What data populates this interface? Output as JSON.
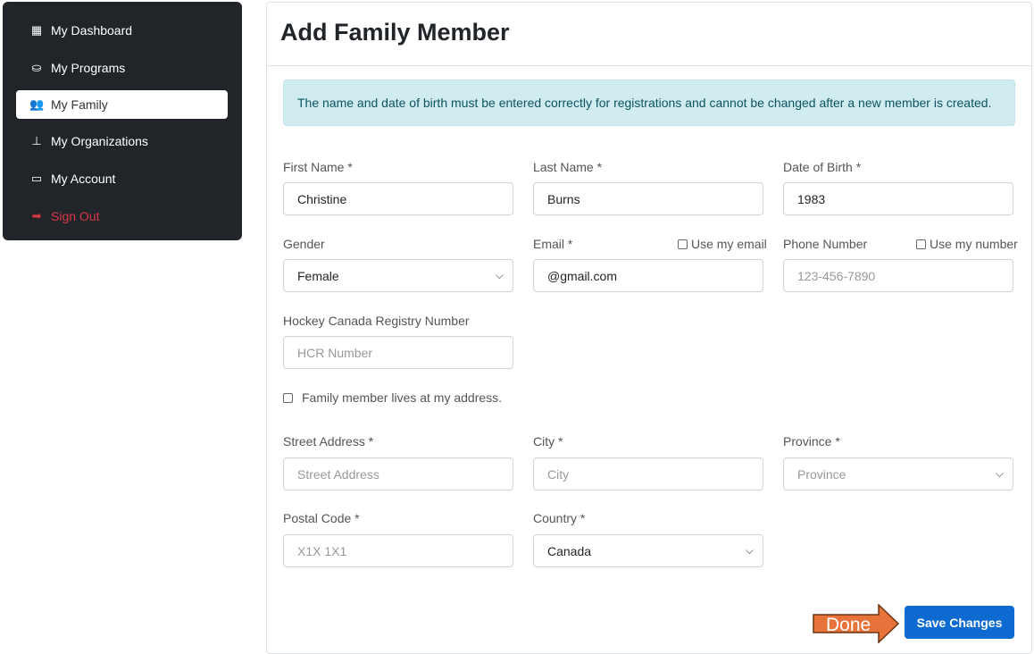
{
  "sidebar": {
    "items": [
      {
        "label": "My Dashboard",
        "icon": "dashboard-icon"
      },
      {
        "label": "My Programs",
        "icon": "basket-icon"
      },
      {
        "label": "My Family",
        "icon": "users-icon",
        "active": true
      },
      {
        "label": "My Organizations",
        "icon": "sitemap-icon"
      },
      {
        "label": "My Account",
        "icon": "wallet-icon"
      },
      {
        "label": "Sign Out",
        "icon": "sign-out-icon"
      }
    ]
  },
  "page": {
    "title": "Add Family Member",
    "alert": "The name and date of birth must be entered correctly for registrations and cannot be changed after a new member is created."
  },
  "form": {
    "first_name": {
      "label": "First Name *",
      "value": "Christine"
    },
    "last_name": {
      "label": "Last Name *",
      "value": "Burns"
    },
    "dob": {
      "label": "Date of Birth *",
      "value": "1983"
    },
    "gender": {
      "label": "Gender",
      "value": "Female"
    },
    "email": {
      "label": "Email *",
      "value": "@gmail.com",
      "checkbox": "Use my email"
    },
    "phone": {
      "label": "Phone Number",
      "placeholder": "123-456-7890",
      "checkbox": "Use my number"
    },
    "hcr": {
      "label": "Hockey Canada Registry Number",
      "placeholder": "HCR Number"
    },
    "same_address": "Family member lives at my address.",
    "street": {
      "label": "Street Address *",
      "placeholder": "Street Address"
    },
    "city": {
      "label": "City *",
      "placeholder": "City"
    },
    "province": {
      "label": "Province *",
      "placeholder": "Province"
    },
    "postal": {
      "label": "Postal Code *",
      "placeholder": "X1X 1X1"
    },
    "country": {
      "label": "Country *",
      "value": "Canada"
    },
    "save": "Save Changes"
  },
  "annotation": {
    "text": "Done",
    "color": "#e8733a"
  }
}
